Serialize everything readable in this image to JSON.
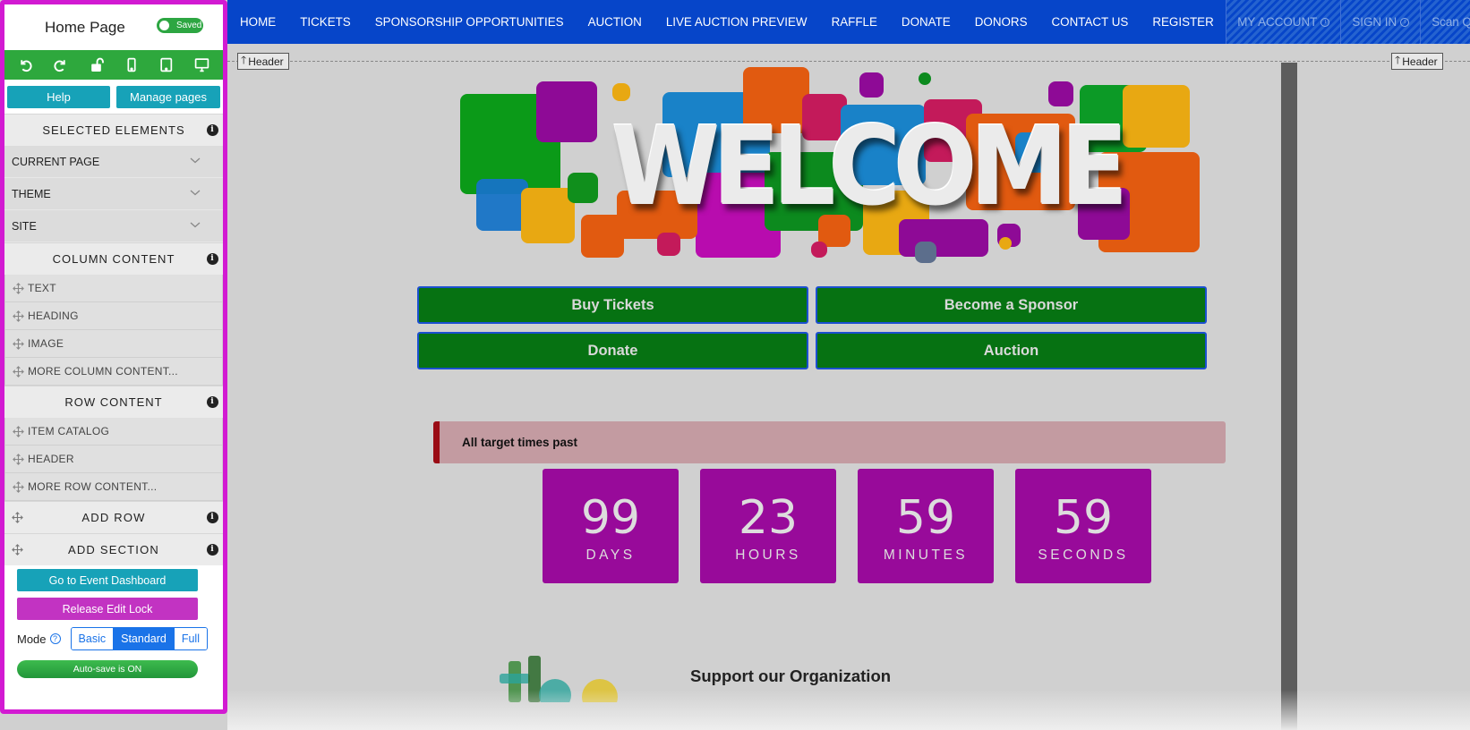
{
  "panel": {
    "title": "Home Page",
    "saved_label": "Saved",
    "help_label": "Help",
    "manage_label": "Manage pages",
    "selected_elements": "SELECTED ELEMENTS",
    "accordion": [
      "CURRENT PAGE",
      "THEME",
      "SITE"
    ],
    "column_content": "COLUMN CONTENT",
    "column_items": [
      "TEXT",
      "HEADING",
      "IMAGE",
      "MORE COLUMN CONTENT..."
    ],
    "row_content": "ROW CONTENT",
    "row_items": [
      "ITEM CATALOG",
      "HEADER",
      "MORE ROW CONTENT..."
    ],
    "add_row": "ADD ROW",
    "add_section": "ADD SECTION",
    "dashboard_label": "Go to Event Dashboard",
    "release_label": "Release Edit Lock",
    "mode_label": "Mode",
    "modes": [
      "Basic",
      "Standard",
      "Full"
    ],
    "active_mode": "Standard",
    "autosave_label": "Auto-save is ON",
    "colors": {
      "border": "#d21ad2",
      "toolbar": "#2ea83d",
      "teal": "#17a2b8",
      "magenta": "#c233c2"
    }
  },
  "nav": {
    "items": [
      "HOME",
      "TICKETS",
      "SPONSORSHIP OPPORTUNITIES",
      "AUCTION",
      "LIVE AUCTION PREVIEW",
      "RAFFLE",
      "DONATE",
      "DONORS",
      "CONTACT US",
      "REGISTER"
    ],
    "my_account": "MY ACCOUNT",
    "sign_in": "SIGN IN",
    "scan_qr": "Scan QR Code",
    "color": "#0645c9"
  },
  "canvas": {
    "header_tag": "Header",
    "hero_text": "WELCOME",
    "buttons": [
      "Buy Tickets",
      "Become a Sponsor",
      "Donate",
      "Auction"
    ],
    "alert": "All target times past",
    "countdown": [
      {
        "value": "99",
        "label": "DAYS"
      },
      {
        "value": "23",
        "label": "HOURS"
      },
      {
        "value": "59",
        "label": "MINUTES"
      },
      {
        "value": "59",
        "label": "SECONDS"
      }
    ],
    "support_heading": "Support our Organization",
    "colors": {
      "cta": "#067212",
      "countdown": "#980a9a",
      "alert_bg": "#c39ba1",
      "alert_bar": "#9a0c15"
    }
  }
}
